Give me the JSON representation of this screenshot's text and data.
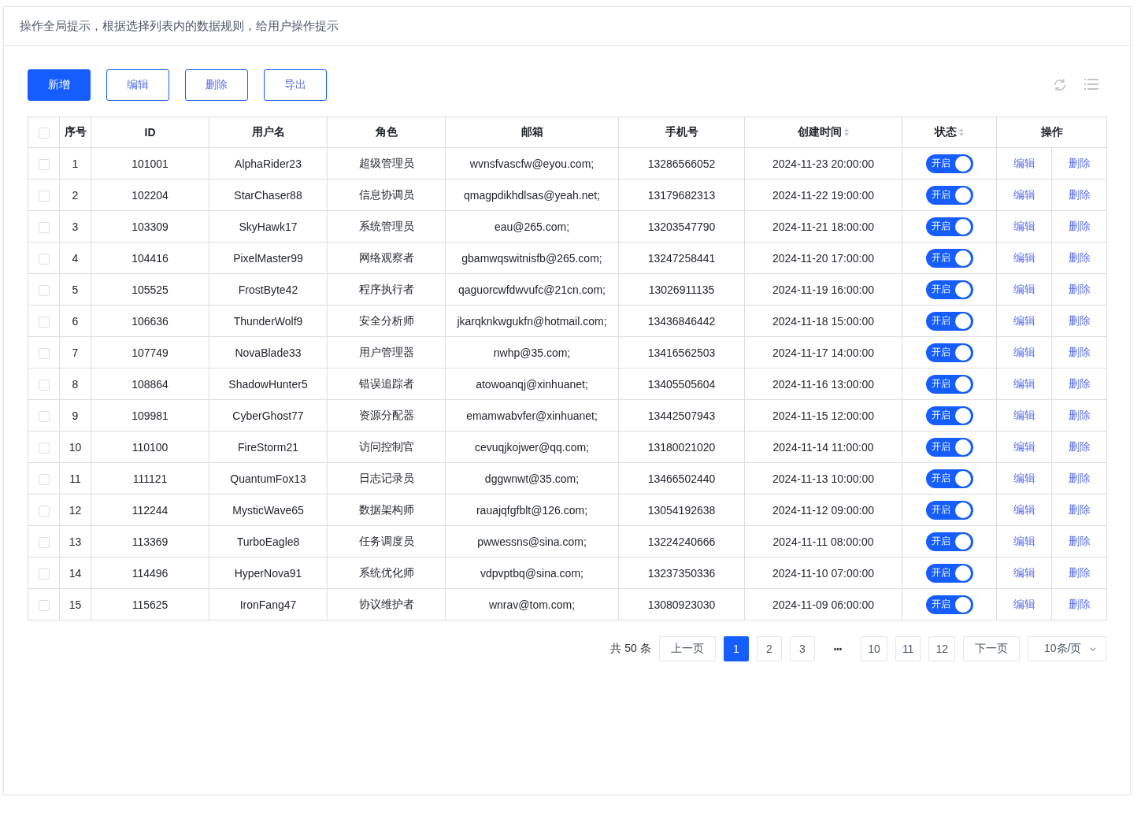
{
  "notice": "操作全局提示，根据选择列表内的数据规则，给用户操作提示",
  "toolbar": {
    "buttons": [
      {
        "label": "新增",
        "kind": "primary"
      },
      {
        "label": "编辑",
        "kind": "outline"
      },
      {
        "label": "删除",
        "kind": "outline"
      },
      {
        "label": "导出",
        "kind": "outline"
      }
    ]
  },
  "table": {
    "select_all": {
      "checked": false
    },
    "columns": [
      {
        "label": "序号",
        "sortable": false
      },
      {
        "label": "ID",
        "sortable": false
      },
      {
        "label": "用户名",
        "sortable": false
      },
      {
        "label": "角色",
        "sortable": false
      },
      {
        "label": "邮箱",
        "sortable": false
      },
      {
        "label": "手机号",
        "sortable": false
      },
      {
        "label": "创建时间",
        "sortable": true
      },
      {
        "label": "状态",
        "sortable": true
      },
      {
        "label": "操作",
        "sortable": false
      }
    ],
    "rows": [
      {
        "checked": false,
        "index": "1",
        "id": "101001",
        "username": "AlphaRider23",
        "role": "超级管理员",
        "email": "wvnsfvascfw@eyou.com;",
        "phone": "13286566052",
        "created": "2024-11-23 20:00:00",
        "status": {
          "label": "开启",
          "on": true
        },
        "actions": [
          "编辑",
          "删除"
        ]
      },
      {
        "checked": false,
        "index": "2",
        "id": "102204",
        "username": "StarChaser88",
        "role": "信息协调员",
        "email": "qmagpdikhdlsas@yeah.net;",
        "phone": "13179682313",
        "created": "2024-11-22 19:00:00",
        "status": {
          "label": "开启",
          "on": true
        },
        "actions": [
          "编辑",
          "删除"
        ]
      },
      {
        "checked": false,
        "index": "3",
        "id": "103309",
        "username": "SkyHawk17",
        "role": "系统管理员",
        "email": "eau@265.com;",
        "phone": "13203547790",
        "created": "2024-11-21 18:00:00",
        "status": {
          "label": "开启",
          "on": true
        },
        "actions": [
          "编辑",
          "删除"
        ]
      },
      {
        "checked": false,
        "index": "4",
        "id": "104416",
        "username": "PixelMaster99",
        "role": "网络观察者",
        "email": "gbamwqswitnisfb@265.com;",
        "phone": "13247258441",
        "created": "2024-11-20 17:00:00",
        "status": {
          "label": "开启",
          "on": true
        },
        "actions": [
          "编辑",
          "删除"
        ]
      },
      {
        "checked": false,
        "index": "5",
        "id": "105525",
        "username": "FrostByte42",
        "role": "程序执行者",
        "email": "qaguorcwfdwvufc@21cn.com;",
        "phone": "13026911135",
        "created": "2024-11-19 16:00:00",
        "status": {
          "label": "开启",
          "on": true
        },
        "actions": [
          "编辑",
          "删除"
        ]
      },
      {
        "checked": false,
        "index": "6",
        "id": "106636",
        "username": "ThunderWolf9",
        "role": "安全分析师",
        "email": "jkarqknkwgukfn@hotmail.com;",
        "phone": "13436846442",
        "created": "2024-11-18 15:00:00",
        "status": {
          "label": "开启",
          "on": true
        },
        "actions": [
          "编辑",
          "删除"
        ]
      },
      {
        "checked": false,
        "index": "7",
        "id": "107749",
        "username": "NovaBlade33",
        "role": "用户管理器",
        "email": "nwhp@35.com;",
        "phone": "13416562503",
        "created": "2024-11-17 14:00:00",
        "status": {
          "label": "开启",
          "on": true
        },
        "actions": [
          "编辑",
          "删除"
        ]
      },
      {
        "checked": false,
        "index": "8",
        "id": "108864",
        "username": "ShadowHunter5",
        "role": "错误追踪者",
        "email": "atowoanqj@xinhuanet;",
        "phone": "13405505604",
        "created": "2024-11-16 13:00:00",
        "status": {
          "label": "开启",
          "on": true
        },
        "actions": [
          "编辑",
          "删除"
        ]
      },
      {
        "checked": false,
        "index": "9",
        "id": "109981",
        "username": "CyberGhost77",
        "role": "资源分配器",
        "email": "emamwabvfer@xinhuanet;",
        "phone": "13442507943",
        "created": "2024-11-15 12:00:00",
        "status": {
          "label": "开启",
          "on": true
        },
        "actions": [
          "编辑",
          "删除"
        ]
      },
      {
        "checked": false,
        "index": "10",
        "id": "110100",
        "username": "FireStorm21",
        "role": "访问控制官",
        "email": "cevuqjkojwer@qq.com;",
        "phone": "13180021020",
        "created": "2024-11-14 11:00:00",
        "status": {
          "label": "开启",
          "on": true
        },
        "actions": [
          "编辑",
          "删除"
        ]
      },
      {
        "checked": false,
        "index": "11",
        "id": "111121",
        "username": "QuantumFox13",
        "role": "日志记录员",
        "email": "dggwnwt@35.com;",
        "phone": "13466502440",
        "created": "2024-11-13 10:00:00",
        "status": {
          "label": "开启",
          "on": true
        },
        "actions": [
          "编辑",
          "删除"
        ]
      },
      {
        "checked": false,
        "index": "12",
        "id": "112244",
        "username": "MysticWave65",
        "role": "数据架构师",
        "email": "rauajqfgfblt@126.com;",
        "phone": "13054192638",
        "created": "2024-11-12 09:00:00",
        "status": {
          "label": "开启",
          "on": true
        },
        "actions": [
          "编辑",
          "删除"
        ]
      },
      {
        "checked": false,
        "index": "13",
        "id": "113369",
        "username": "TurboEagle8",
        "role": "任务调度员",
        "email": "pwwessns@sina.com;",
        "phone": "13224240666",
        "created": "2024-11-11 08:00:00",
        "status": {
          "label": "开启",
          "on": true
        },
        "actions": [
          "编辑",
          "删除"
        ]
      },
      {
        "checked": false,
        "index": "14",
        "id": "114496",
        "username": "HyperNova91",
        "role": "系统优化师",
        "email": "vdpvptbq@sina.com;",
        "phone": "13237350336",
        "created": "2024-11-10 07:00:00",
        "status": {
          "label": "开启",
          "on": true
        },
        "actions": [
          "编辑",
          "删除"
        ]
      },
      {
        "checked": false,
        "index": "15",
        "id": "115625",
        "username": "IronFang47",
        "role": "协议维护者",
        "email": "wnrav@tom.com;",
        "phone": "13080923030",
        "created": "2024-11-09 06:00:00",
        "status": {
          "label": "开启",
          "on": true
        },
        "actions": [
          "编辑",
          "删除"
        ]
      }
    ]
  },
  "pagination": {
    "total": "共 50 条",
    "prev": "上一页",
    "pages": [
      {
        "label": "1",
        "selected": true
      },
      {
        "label": "2",
        "selected": false
      },
      {
        "label": "3",
        "selected": false
      },
      {
        "label": "•••",
        "kind": "ellipsis",
        "selected": false
      },
      {
        "label": "10",
        "selected": false
      },
      {
        "label": "11",
        "selected": false
      },
      {
        "label": "12",
        "selected": false
      }
    ],
    "next": "下一页",
    "page_size": "10条/页"
  }
}
